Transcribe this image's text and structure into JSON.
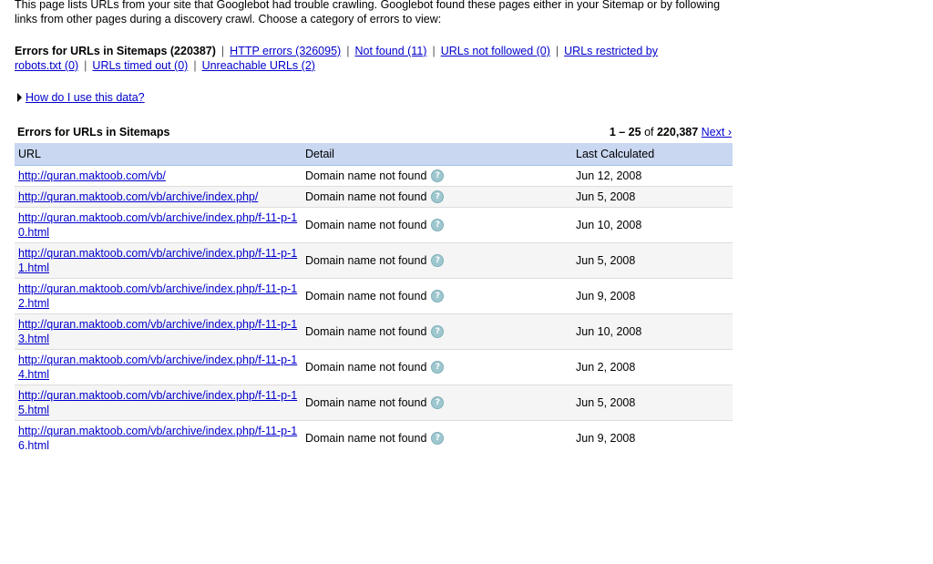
{
  "intro": {
    "text": "This page lists URLs from your site that Googlebot had trouble crawling. Googlebot found these pages either in your Sitemap or by following links from other pages during a discovery crawl. Choose a category of errors to view:"
  },
  "categories": {
    "current": "Errors for URLs in Sitemaps (220387)",
    "links": [
      "HTTP errors (326095)",
      "Not found (11)",
      "URLs not followed (0)",
      "URLs restricted by robots.txt (0)",
      "URLs timed out (0)",
      "Unreachable URLs (2)"
    ]
  },
  "help": {
    "label": "How do I use this data?"
  },
  "table": {
    "title": "Errors for URLs in Sitemaps",
    "pager": {
      "range": "1 – 25",
      "of": "of",
      "total": "220,387",
      "next": "Next ›"
    },
    "columns": {
      "url": "URL",
      "detail": "Detail",
      "date": "Last Calculated"
    },
    "rows": [
      {
        "url": "http://quran.maktoob.com/vb/",
        "detail": "Domain name not found",
        "date": "Jun 12, 2008"
      },
      {
        "url": "http://quran.maktoob.com/vb/archive/index.php/",
        "detail": "Domain name not found",
        "date": "Jun 5, 2008"
      },
      {
        "url": "http://quran.maktoob.com/vb/archive/index.php/f-11-p-10.html",
        "detail": "Domain name not found",
        "date": "Jun 10, 2008"
      },
      {
        "url": "http://quran.maktoob.com/vb/archive/index.php/f-11-p-11.html",
        "detail": "Domain name not found",
        "date": "Jun 5, 2008"
      },
      {
        "url": "http://quran.maktoob.com/vb/archive/index.php/f-11-p-12.html",
        "detail": "Domain name not found",
        "date": "Jun 9, 2008"
      },
      {
        "url": "http://quran.maktoob.com/vb/archive/index.php/f-11-p-13.html",
        "detail": "Domain name not found",
        "date": "Jun 10, 2008"
      },
      {
        "url": "http://quran.maktoob.com/vb/archive/index.php/f-11-p-14.html",
        "detail": "Domain name not found",
        "date": "Jun 2, 2008"
      },
      {
        "url": "http://quran.maktoob.com/vb/archive/index.php/f-11-p-15.html",
        "detail": "Domain name not found",
        "date": "Jun 5, 2008"
      },
      {
        "url": "http://quran.maktoob.com/vb/archive/index.php/f-11-p-16.html",
        "detail": "Domain name not found",
        "date": "Jun 9, 2008"
      }
    ],
    "help_icon_glyph": "?"
  },
  "colors": {
    "link": "#0000cc",
    "header_bg": "#c9d7f1",
    "alt_row_bg": "#f5f5f5",
    "help_icon": "#9fc7cf"
  },
  "icons": {
    "help": "question-mark-icon",
    "disclosure": "triangle-right-icon"
  }
}
